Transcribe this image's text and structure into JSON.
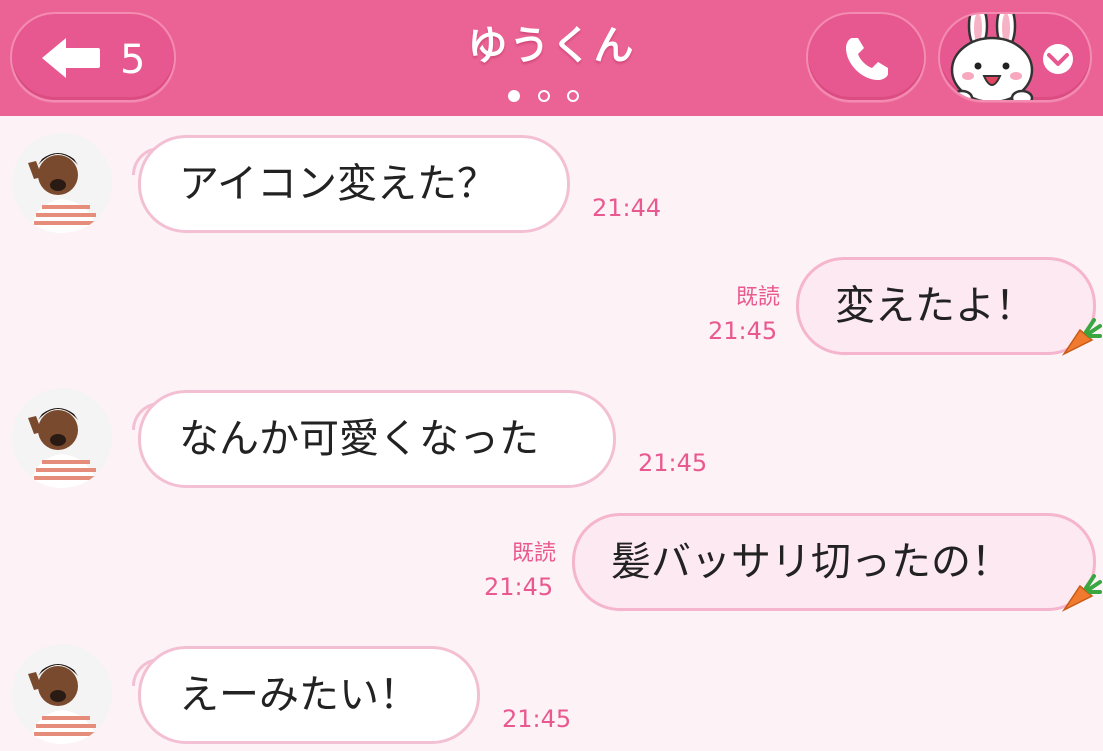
{
  "header": {
    "back_count": "5",
    "title": "ゆうくん",
    "pages": 3,
    "active_page": 1,
    "background_color": "#eb6294"
  },
  "messages": [
    {
      "side": "left",
      "text": "アイコン変えた？",
      "time": "21:44"
    },
    {
      "side": "right",
      "text": "変えたよ！",
      "read": "既読",
      "time": "21:45"
    },
    {
      "side": "left",
      "text": "なんか可愛くなった",
      "time": "21:45"
    },
    {
      "side": "right",
      "text": "髪バッサリ切ったの！",
      "read": "既読",
      "time": "21:45"
    },
    {
      "side": "left",
      "text": "えーみたい！",
      "time": "21:45"
    }
  ]
}
